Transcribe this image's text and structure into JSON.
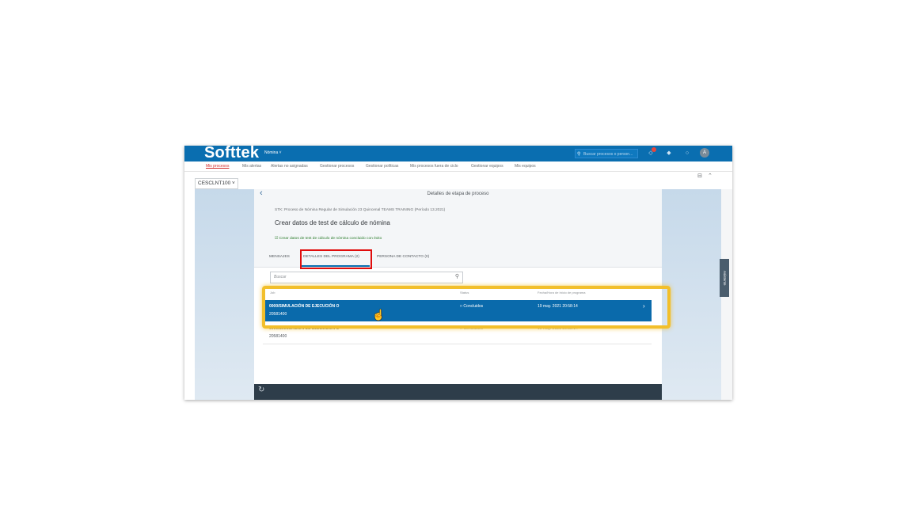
{
  "shell": {
    "logo": "Softtek",
    "module": "Nómina ˅",
    "search_placeholder": "Buscar procesos o person...",
    "avatar": "A"
  },
  "nav": [
    "Mis procesos",
    "Mis alertas",
    "Alertas no asignadas",
    "Gestionar procesos",
    "Gestionar políticas",
    "Mis procesos fuera de ciclo",
    "Gestionar equipos",
    "Mis equipos"
  ],
  "context_dropdown": "CESCLNT100 ˅",
  "side_tab": "Asistente",
  "card": {
    "title": "Detalles de etapa de proceso",
    "process_line": "STK: Proceso de Nómina Regular de Simulación 23 Quincenal TEAMS TRAINING (Período 13.2021)",
    "step_title": "Crear datos de test de cálculo de nómina",
    "status_message": "Crear datos de test de cálculo de nómina concluido con éxito",
    "tabs": [
      "MENSAJES",
      "DETALLES DEL PROGRAMA (2)",
      "PERSONA DE CONTACTO (0)"
    ],
    "search_placeholder": "Buscar",
    "columns": [
      "Job",
      "Status",
      "Fecha/Hora de inicio de programa"
    ],
    "rows": [
      {
        "title": "0000/SIMULACIÓN DE EJECUCIÓN O",
        "sub": "20581400",
        "status": "Concluidos",
        "date": "19 may. 2021 20:58:14"
      },
      {
        "title": "0000/SIMULACIÓN DE EJECUCIÓN O",
        "sub": "20581400",
        "status": "Concluidos",
        "date": "19 may. 2021 20:58:14"
      }
    ]
  }
}
